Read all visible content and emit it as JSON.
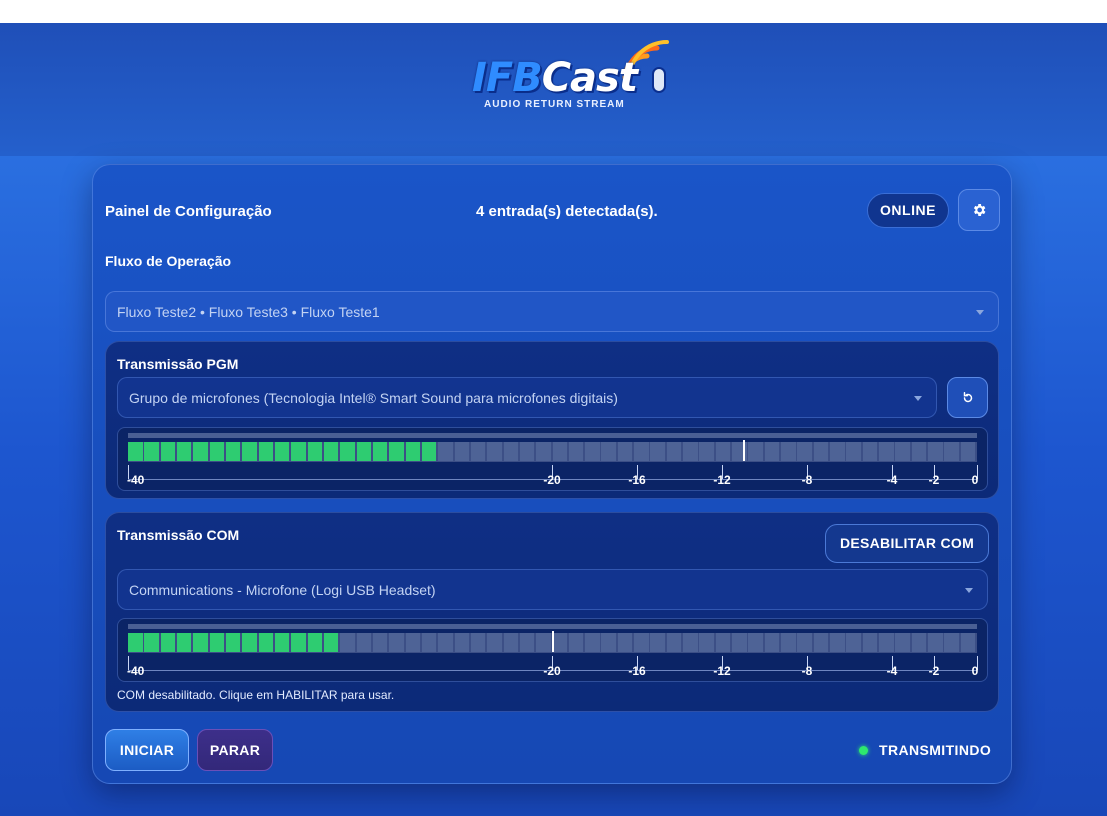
{
  "logo": {
    "brand_part1": "IFB",
    "brand_part2": "Cast",
    "tagline": "AUDIO RETURN STREAM"
  },
  "panel": {
    "title": "Painel de Configuração",
    "detected_inputs": "4 entrada(s) detectada(s).",
    "status_badge": "ONLINE",
    "settings_icon": "gear-icon"
  },
  "flow": {
    "label": "Fluxo de Operação",
    "selected": "Fluxo Teste2 • Fluxo Teste3 • Fluxo Teste1"
  },
  "pgm": {
    "title": "Transmissão PGM",
    "device": "Grupo de microfones (Tecnologia Intel® Smart Sound para microfones digitais)",
    "refresh_icon": "refresh-icon",
    "meter": {
      "segments": 52,
      "active": 19,
      "peak_db": -11
    }
  },
  "com": {
    "title": "Transmissão COM",
    "toggle_label": "DESABILITAR COM",
    "device": "Communications - Microfone (Logi USB Headset)",
    "meter": {
      "segments": 52,
      "active": 13,
      "peak_db": -20
    },
    "note": "COM desabilitado. Clique em HABILITAR para usar."
  },
  "scale": [
    "-40",
    "-20",
    "-16",
    "-12",
    "-8",
    "-4",
    "-2",
    "0"
  ],
  "colors": {
    "meter_active": "#2ecc71",
    "status_dot": "#2ee86e"
  },
  "controls": {
    "start": "INICIAR",
    "stop": "PARAR",
    "status": "TRANSMITINDO"
  }
}
